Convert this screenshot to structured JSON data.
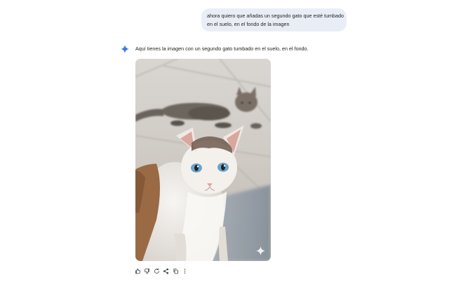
{
  "user_message": {
    "line1": "ahora quiero que añadas un segundo gato que esté tumbado",
    "line2": "en el suelo, en el fondo de la imagen"
  },
  "assistant": {
    "icon": "gemini-sparkle-icon",
    "reply_text": "Aquí tienes la imagen con un segundo gato tumbado en el suelo, en el fondo.",
    "image": {
      "description_icon": "sparkle-watermark-icon"
    }
  },
  "actions": [
    {
      "name": "thumbs-up-icon"
    },
    {
      "name": "thumbs-down-icon"
    },
    {
      "name": "regenerate-icon"
    },
    {
      "name": "share-icon"
    },
    {
      "name": "copy-icon"
    },
    {
      "name": "more-options-icon"
    }
  ],
  "colors": {
    "user_bubble": "#e9eef6",
    "accent_blue": "#4285f4",
    "icon_gray": "#444746"
  }
}
